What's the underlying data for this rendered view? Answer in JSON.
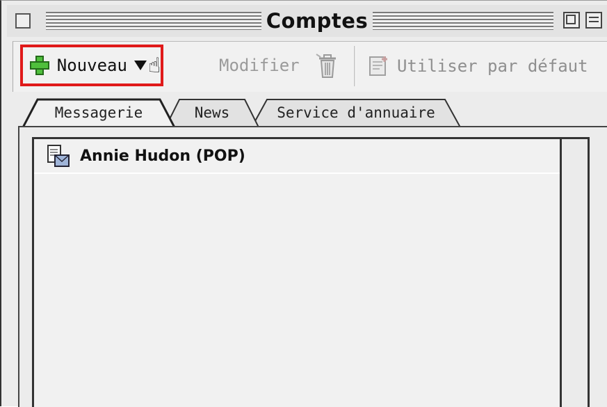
{
  "window": {
    "title": "Comptes"
  },
  "toolbar": {
    "new_label": "Nouveau",
    "modify_label": "Modifier",
    "default_label": "Utiliser par défaut"
  },
  "tabs": [
    {
      "label": "Messagerie",
      "selected": true
    },
    {
      "label": "News",
      "selected": false
    },
    {
      "label": "Service d'annuaire",
      "selected": false
    }
  ],
  "accounts": [
    {
      "label": "Annie Hudon (POP)",
      "icon": "mail-account-icon"
    }
  ],
  "colors": {
    "highlight_border": "#e01a1a",
    "plus_green": "#4fbf3c"
  }
}
